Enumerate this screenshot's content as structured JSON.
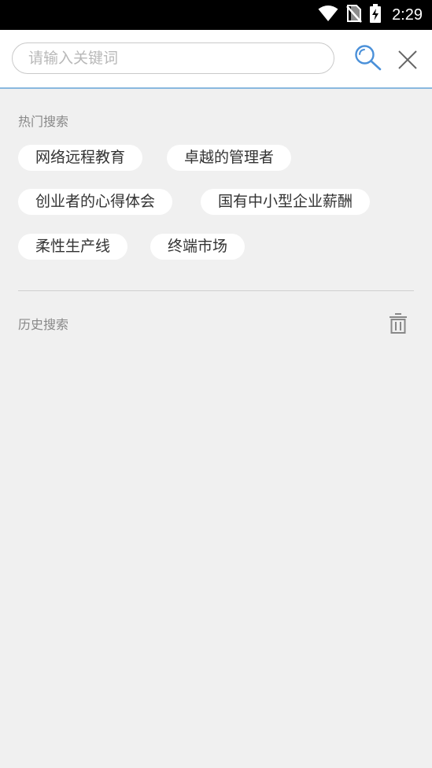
{
  "status_bar": {
    "time": "2:29",
    "icons": [
      "wifi-icon",
      "no-sim-icon",
      "battery-charging-icon"
    ]
  },
  "search": {
    "placeholder": "请输入关键词",
    "value": "",
    "accent_color": "#4a90d9"
  },
  "hot_search": {
    "title": "热门搜索",
    "tags": [
      "网络远程教育",
      "卓越的管理者",
      "创业者的心得体会",
      "国有中小型企业薪酬",
      "柔性生产线",
      "终端市场"
    ]
  },
  "history_search": {
    "title": "历史搜索",
    "items": []
  }
}
